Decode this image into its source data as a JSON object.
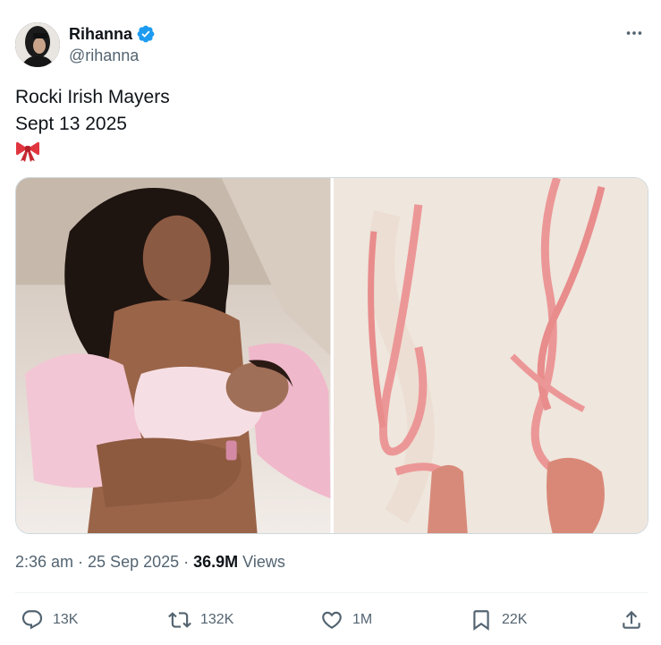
{
  "author": {
    "display_name": "Rihanna",
    "handle": "@rihanna",
    "verified": true
  },
  "tweet": {
    "lines": [
      "Rocki Irish Mayers",
      "Sept 13 2025"
    ],
    "emoji": "ribbon-bow",
    "timestamp": "2:36 am · 25 Sep 2025 · ",
    "views_count": "36.9M",
    "views_label": " Views"
  },
  "actions": {
    "replies": "13K",
    "reposts": "132K",
    "likes": "1M",
    "bookmarks": "22K"
  },
  "icons": [
    "verified-badge-icon",
    "more-icon",
    "reply-icon",
    "repost-icon",
    "like-icon",
    "bookmark-icon",
    "share-icon"
  ],
  "colors": {
    "verified_blue": "#1d9bf0",
    "text_primary": "#0f1419",
    "text_secondary": "#536471",
    "ribbon_pink": "#e8898f"
  }
}
